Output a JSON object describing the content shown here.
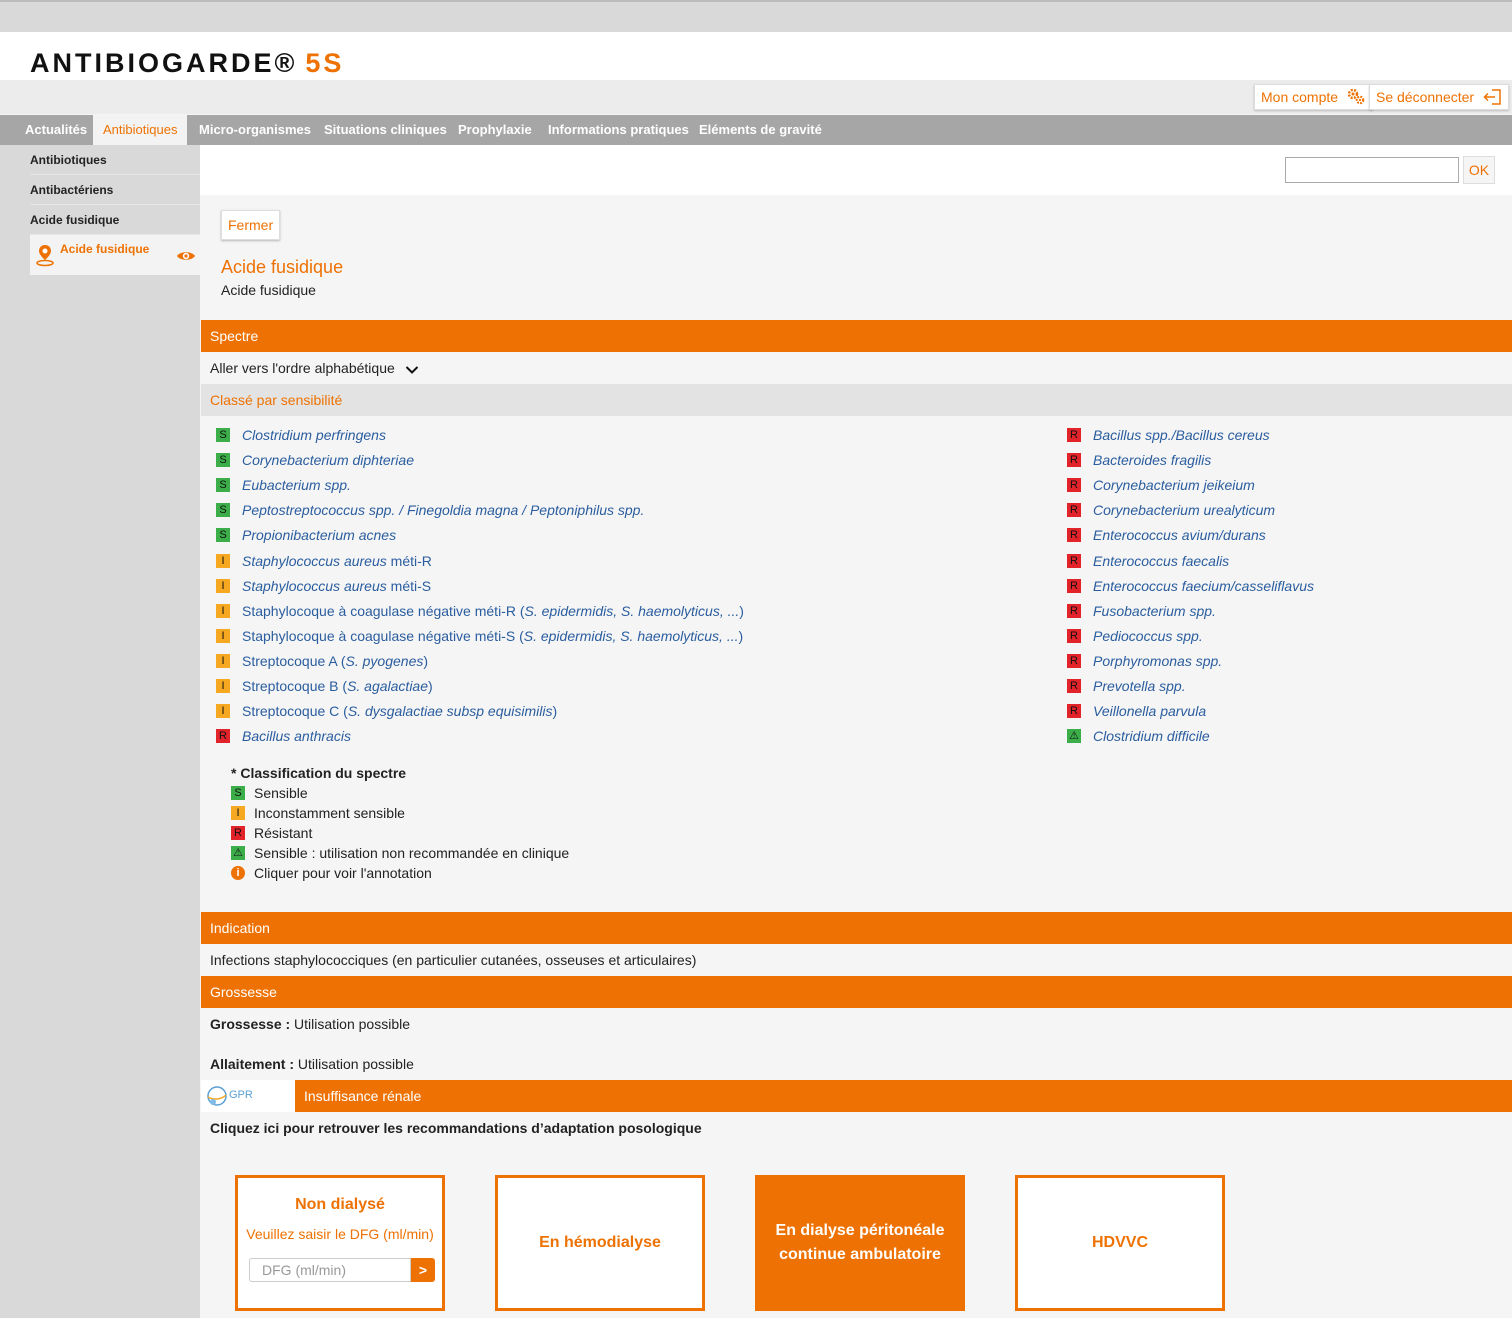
{
  "app": {
    "logo_main": "ANTIBIOGARDE®",
    "logo_suffix": "5S"
  },
  "userbar": {
    "account_label": "Mon compte",
    "logout_label": "Se déconnecter"
  },
  "nav": {
    "items": [
      {
        "label": "Actualités"
      },
      {
        "label": "Antibiotiques",
        "active": true
      },
      {
        "label": "Micro-organismes"
      },
      {
        "label": "Situations cliniques"
      },
      {
        "label": "Prophylaxie"
      },
      {
        "label": "Informations pratiques"
      },
      {
        "label": "Eléments de gravité"
      }
    ]
  },
  "sidebar": {
    "items": [
      {
        "label": "Antibiotiques"
      },
      {
        "label": "Antibactériens"
      },
      {
        "label": "Acide fusidique"
      }
    ],
    "active_item": "Acide fusidique"
  },
  "search": {
    "value": "",
    "ok_label": "OK"
  },
  "drug": {
    "close_label": "Fermer",
    "title": "Acide fusidique",
    "subtitle": "Acide fusidique"
  },
  "spectre": {
    "header": "Spectre",
    "alpha_label": "Aller vers l'ordre alphabétique",
    "sens_label": "Classé par sensibilité",
    "left": [
      {
        "badge": "S",
        "parts": [
          [
            "i",
            "Clostridium perfringens"
          ]
        ]
      },
      {
        "badge": "S",
        "parts": [
          [
            "i",
            "Corynebacterium diphteriae"
          ]
        ]
      },
      {
        "badge": "S",
        "parts": [
          [
            "i",
            "Eubacterium spp."
          ]
        ]
      },
      {
        "badge": "S",
        "parts": [
          [
            "i",
            "Peptostreptococcus spp. / Finegoldia magna / Peptoniphilus spp."
          ]
        ]
      },
      {
        "badge": "S",
        "parts": [
          [
            "i",
            "Propionibacterium acnes"
          ]
        ]
      },
      {
        "badge": "I",
        "parts": [
          [
            "i",
            "Staphylococcus aureus"
          ],
          [
            "n",
            " méti-R"
          ]
        ]
      },
      {
        "badge": "I",
        "parts": [
          [
            "i",
            "Staphylococcus aureus"
          ],
          [
            "n",
            " méti-S"
          ]
        ]
      },
      {
        "badge": "I",
        "parts": [
          [
            "n",
            "Staphylocoque à coagulase négative méti-R ("
          ],
          [
            "i",
            "S. epidermidis, S. haemolyticus, ..."
          ],
          [
            "n",
            ")"
          ]
        ]
      },
      {
        "badge": "I",
        "parts": [
          [
            "n",
            "Staphylocoque à coagulase négative méti-S ("
          ],
          [
            "i",
            "S. epidermidis, S. haemolyticus, ..."
          ],
          [
            "n",
            ")"
          ]
        ]
      },
      {
        "badge": "I",
        "parts": [
          [
            "n",
            "Streptocoque A ("
          ],
          [
            "i",
            "S. pyogenes"
          ],
          [
            "n",
            ")"
          ]
        ]
      },
      {
        "badge": "I",
        "parts": [
          [
            "n",
            "Streptocoque B ("
          ],
          [
            "i",
            "S. agalactiae"
          ],
          [
            "n",
            ")"
          ]
        ]
      },
      {
        "badge": "I",
        "parts": [
          [
            "n",
            "Streptocoque C ("
          ],
          [
            "i",
            "S. dysgalactiae subsp equisimilis"
          ],
          [
            "n",
            ")"
          ]
        ]
      },
      {
        "badge": "R",
        "parts": [
          [
            "i",
            "Bacillus anthracis"
          ]
        ]
      }
    ],
    "right": [
      {
        "badge": "R",
        "parts": [
          [
            "i",
            "Bacillus spp./Bacillus cereus"
          ]
        ]
      },
      {
        "badge": "R",
        "parts": [
          [
            "i",
            "Bacteroides fragilis"
          ]
        ]
      },
      {
        "badge": "R",
        "parts": [
          [
            "i",
            "Corynebacterium jeikeium"
          ]
        ]
      },
      {
        "badge": "R",
        "parts": [
          [
            "i",
            "Corynebacterium urealyticum"
          ]
        ]
      },
      {
        "badge": "R",
        "parts": [
          [
            "i",
            "Enterococcus avium/durans"
          ]
        ]
      },
      {
        "badge": "R",
        "parts": [
          [
            "i",
            "Enterococcus faecalis"
          ]
        ]
      },
      {
        "badge": "R",
        "parts": [
          [
            "i",
            "Enterococcus faecium/casseliflavus"
          ]
        ]
      },
      {
        "badge": "R",
        "parts": [
          [
            "i",
            "Fusobacterium spp."
          ]
        ]
      },
      {
        "badge": "R",
        "parts": [
          [
            "i",
            "Pediococcus spp."
          ]
        ]
      },
      {
        "badge": "R",
        "parts": [
          [
            "i",
            "Porphyromonas spp."
          ]
        ]
      },
      {
        "badge": "R",
        "parts": [
          [
            "i",
            "Prevotella spp."
          ]
        ]
      },
      {
        "badge": "R",
        "parts": [
          [
            "i",
            "Veillonella parvula"
          ]
        ]
      },
      {
        "badge": "W",
        "parts": [
          [
            "i",
            "Clostridium difficile"
          ]
        ]
      }
    ],
    "legend": {
      "title": "* Classification du spectre",
      "items": [
        {
          "badge": "S",
          "label": "Sensible"
        },
        {
          "badge": "I",
          "label": "Inconstamment sensible"
        },
        {
          "badge": "R",
          "label": "Résistant"
        },
        {
          "badge": "W",
          "label": "Sensible : utilisation non recommandée en clinique"
        },
        {
          "badge": "info",
          "label": "Cliquer pour voir l'annotation"
        }
      ]
    }
  },
  "badge_glyphs": {
    "S": "S",
    "I": "I",
    "R": "R",
    "W": "⚠",
    "info": "i"
  },
  "colors": {
    "accent": "#ee7203",
    "sensible": "#3cae49",
    "inconstant": "#f6a821",
    "resistant": "#e2242a",
    "link": "#2a5d9f"
  },
  "indication": {
    "header": "Indication",
    "text": "Infections staphylococciques (en particulier cutanées, osseuses et articulaires)"
  },
  "grossesse": {
    "header": "Grossesse",
    "grossesse_label": "Grossesse :",
    "grossesse_value": " Utilisation possible",
    "allaitement_label": "Allaitement :",
    "allaitement_value": " Utilisation possible"
  },
  "renal": {
    "gpr_logo": "GPR",
    "header": "Insuffisance rénale",
    "link_text": "Cliquez ici pour retrouver les recommandations d’adaptation posologique",
    "non_dialyse": {
      "title": "Non dialysé",
      "subtitle": "Veuillez saisir le DFG (ml/min)",
      "placeholder": "DFG (ml/min)",
      "go": ">"
    },
    "hemodialyse": "En hémodialyse",
    "dpca": "En dialyse péritonéale continue ambulatoire",
    "hdvvc": "HDVVC"
  }
}
